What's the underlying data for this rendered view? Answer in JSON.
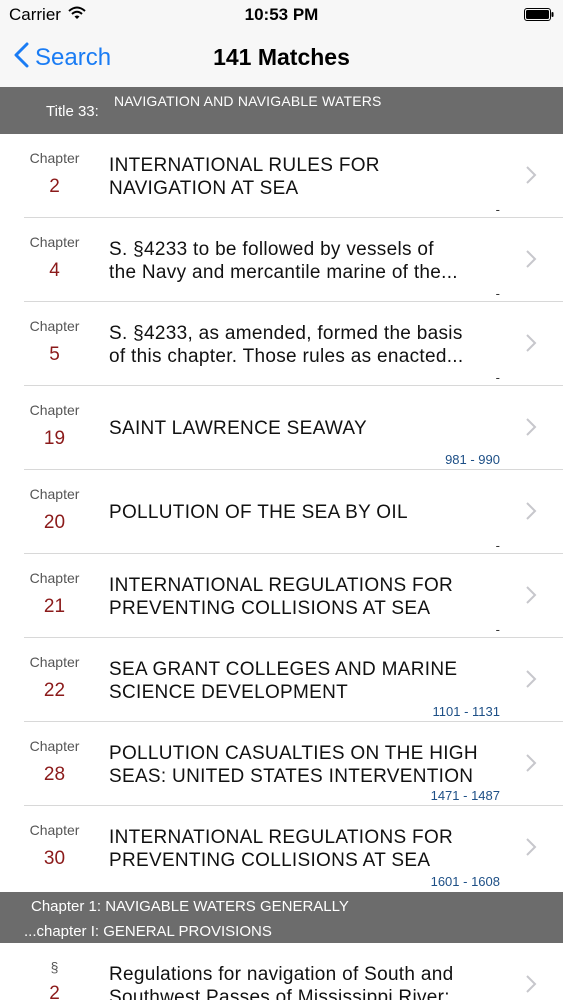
{
  "status_bar": {
    "carrier": "Carrier",
    "time": "10:53 PM"
  },
  "nav": {
    "back_label": "Search",
    "title": "141 Matches"
  },
  "section_title33": {
    "prefix": "Title 33:",
    "subtitle": "NAVIGATION AND NAVIGABLE WATERS"
  },
  "rows": [
    {
      "kind": "Chapter",
      "num": "2",
      "line1": "INTERNATIONAL RULES FOR",
      "line2": "NAVIGATION AT SEA",
      "range": "-"
    },
    {
      "kind": "Chapter",
      "num": "4",
      "line1": "S. §4233 to be followed by vessels of",
      "line2": "the Navy and mercantile marine of the...",
      "range": "-"
    },
    {
      "kind": "Chapter",
      "num": "5",
      "line1": "S. §4233, as amended, formed the basis",
      "line2": "of this chapter. Those rules as enacted...",
      "range": "-"
    },
    {
      "kind": "Chapter",
      "num": "19",
      "line1": "SAINT LAWRENCE SEAWAY",
      "line2": "",
      "range": "981 - 990"
    },
    {
      "kind": "Chapter",
      "num": "20",
      "line1": "POLLUTION OF THE SEA BY OIL",
      "line2": "",
      "range": "-"
    },
    {
      "kind": "Chapter",
      "num": "21",
      "line1": "INTERNATIONAL REGULATIONS FOR",
      "line2": "PREVENTING COLLISIONS AT SEA",
      "range": "-"
    },
    {
      "kind": "Chapter",
      "num": "22",
      "line1": "SEA GRANT COLLEGES AND MARINE",
      "line2": "SCIENCE DEVELOPMENT",
      "range": "1101 - 1131"
    },
    {
      "kind": "Chapter",
      "num": "28",
      "line1": "POLLUTION CASUALTIES ON THE HIGH",
      "line2": "SEAS: UNITED STATES INTERVENTION",
      "range": "1471 - 1487"
    },
    {
      "kind": "Chapter",
      "num": "30",
      "line1": "INTERNATIONAL REGULATIONS FOR",
      "line2": "PREVENTING COLLISIONS AT SEA",
      "range": "1601 - 1608"
    }
  ],
  "section_chapter1": {
    "line1": "Chapter 1: NAVIGABLE WATERS GENERALLY",
    "line2": "...chapter I: GENERAL PROVISIONS"
  },
  "last_row": {
    "kind": "§",
    "num": "2",
    "line1": "Regulations for navigation of South and",
    "line2": "Southwest Passes of Mississippi River;"
  },
  "colors": {
    "accent": "#1a7cf4",
    "chapter_number": "#8b1a1a",
    "section_header_bg": "#6c6c6c",
    "range_text": "#1d4f86"
  },
  "icons": {
    "back": "chevron-left-icon",
    "row": "chevron-right-icon",
    "wifi": "wifi-icon",
    "battery": "battery-icon"
  }
}
